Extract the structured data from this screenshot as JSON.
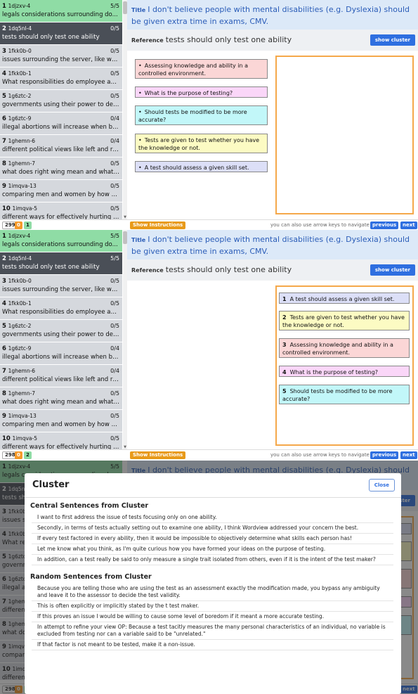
{
  "sidebar_items": [
    {
      "num": "1",
      "code": "1djzxv-4",
      "score": "5/5",
      "text": "legals considerations surrounding do..."
    },
    {
      "num": "2",
      "code": "1dq5nl-4",
      "score": "0/5",
      "text": "tests should only test one ability"
    },
    {
      "num": "3",
      "code": "1fkk0b-0",
      "score": "0/5",
      "text": "issues surrounding the server, like wh..."
    },
    {
      "num": "4",
      "code": "1fkk0b-1",
      "score": "0/5",
      "text": "What responsibilities do employee an..."
    },
    {
      "num": "5",
      "code": "1g6ztc-2",
      "score": "0/5",
      "text": "governments using their power to def..."
    },
    {
      "num": "6",
      "code": "1g6ztc-9",
      "score": "0/4",
      "text": "illegal abortions will increase when ba..."
    },
    {
      "num": "7",
      "code": "1ghemn-6",
      "score": "0/4",
      "text": "different political views like left and ri..."
    },
    {
      "num": "8",
      "code": "1ghemn-7",
      "score": "0/5",
      "text": "what does right wing mean and what t..."
    },
    {
      "num": "9",
      "code": "1imqva-13",
      "score": "0/5",
      "text": "comparing men and women by how a..."
    },
    {
      "num": "10",
      "code": "1imqva-5",
      "score": "0/5",
      "text": "different ways for effectively hurting s..."
    }
  ],
  "panel2_item2_score": "5/5",
  "title_label": "Title",
  "title_text": "I don't believe people with mental disabilities (e.g. Dyslexia) should be given extra time in exams, CMV.",
  "reference_label": "Reference",
  "reference_text": "tests should only test one ability",
  "show_cluster_label": "show cluster",
  "show_instructions_label": "Show Instructions",
  "hint_text": "you can also use arrow keys to navigate",
  "previous_label": "previous",
  "next_label": "next",
  "panel1_bottom": {
    "count": "299",
    "zero": "0",
    "value": "1"
  },
  "panel2_bottom": {
    "count": "298",
    "zero": "0",
    "value": "2"
  },
  "panel3_bottom": {
    "count": "298",
    "zero": "0",
    "value": "2"
  },
  "bullet": "•",
  "panel1_cards": [
    "Assessing knowledge and ability in a controlled environment.",
    "What is the purpose of testing?",
    "Should tests be modified to be more accurate?",
    "Tests are given to test whether you have the knowledge or not.",
    "A test should assess a given skill set."
  ],
  "panel2_cards": [
    {
      "n": "1",
      "text": "A test should assess a given skill set."
    },
    {
      "n": "2",
      "text": "Tests are given to test whether you have the knowledge or not."
    },
    {
      "n": "3",
      "text": "Assessing knowledge and ability in a controlled environment."
    },
    {
      "n": "4",
      "text": "What is the purpose of testing?"
    },
    {
      "n": "5",
      "text": "Should tests be modified to be more accurate?"
    }
  ],
  "modal": {
    "title": "Cluster",
    "close_label": "Close",
    "central_heading": "Central Sentences from Cluster",
    "central": [
      "I want to first address the issue of tests focusing only on one ability.",
      "Secondly, in terms of tests actually setting out to examine one ability, I think Wordview addressed your concern the best.",
      "If every test factored in every ability, then it would be impossible to objectively determine what skills each person has!",
      "Let me know what you think, as I'm quite curious how you have formed your ideas on the purpose of testing.",
      "In addition, can a test really be said to only measure a single trait isolated from others, even if it is the intent of the test maker?"
    ],
    "random_heading": "Random Sentences from Cluster",
    "random": [
      "Because you are telling those who are using the test as an assessment exactly the modification made, you bypass any ambiguity and leave it to the assessor to decide the test validity.",
      "This is often explicitly or implicitly stated by the t test maker.",
      "If this proves an issue I would be willing to cause some level of boredom if it meant a more accurate testing.",
      "In attempt to refine your view OP: Because a test tacitly measures the many personal characteristics of an individual, no variable is excluded from testing nor can a variable said to be \"unrelated.\"",
      "If that factor is not meant to be tested, make it a non-issue."
    ]
  },
  "colors": {
    "accent": "#2f6fe0",
    "active_green": "#8fdca5",
    "selected_dark": "#4a4f57",
    "title_bg": "#dce9f8",
    "dropzone_orange": "#f5a84a"
  }
}
